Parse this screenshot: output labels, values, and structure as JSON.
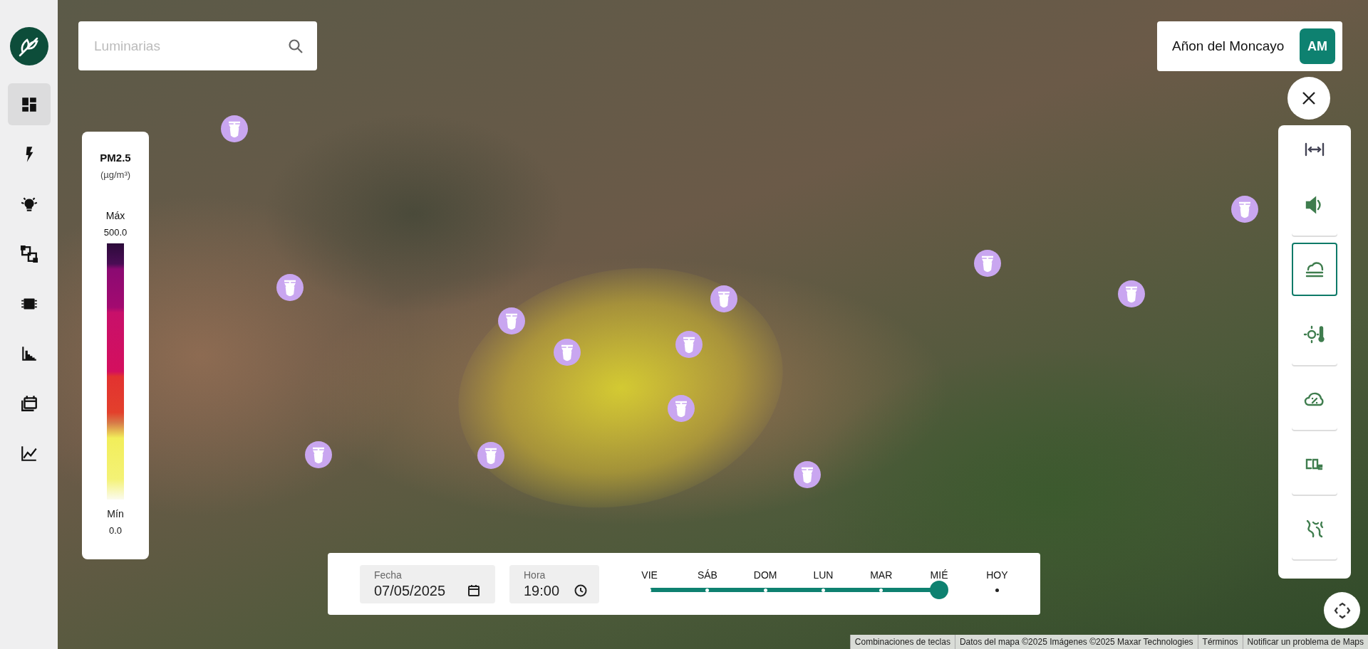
{
  "sidebar": {
    "items": [
      {
        "selected": true
      },
      {
        "selected": false
      },
      {
        "selected": false
      },
      {
        "selected": false
      },
      {
        "selected": false
      },
      {
        "selected": false
      },
      {
        "selected": false
      },
      {
        "selected": false
      }
    ]
  },
  "search": {
    "placeholder": "Luminarias"
  },
  "legend": {
    "title": "PM2.5",
    "unit": "(µg/m³)",
    "max_label": "Máx",
    "max_value": "500.0",
    "min_label": "Mín",
    "min_value": "0.0"
  },
  "location": {
    "name": "Añon del Moncayo",
    "initials": "AM"
  },
  "toolbar": {
    "items": [
      {
        "selected": false
      },
      {
        "selected": false
      },
      {
        "selected": true
      },
      {
        "selected": false
      },
      {
        "selected": false
      },
      {
        "selected": false
      },
      {
        "selected": false
      }
    ]
  },
  "date_field": {
    "label": "Fecha",
    "value": "07/05/2025"
  },
  "time_field": {
    "label": "Hora",
    "value": "19:00"
  },
  "timeline": {
    "days": [
      "VIE",
      "SÁB",
      "DOM",
      "LUN",
      "MAR",
      "MIÉ",
      "HOY"
    ],
    "level": 0.833
  },
  "attribution": [
    "Combinaciones de teclas",
    "Datos del mapa ©2025 Imágenes ©2025 Maxar Technologies",
    "Términos",
    "Notificar un problema de Maps"
  ]
}
